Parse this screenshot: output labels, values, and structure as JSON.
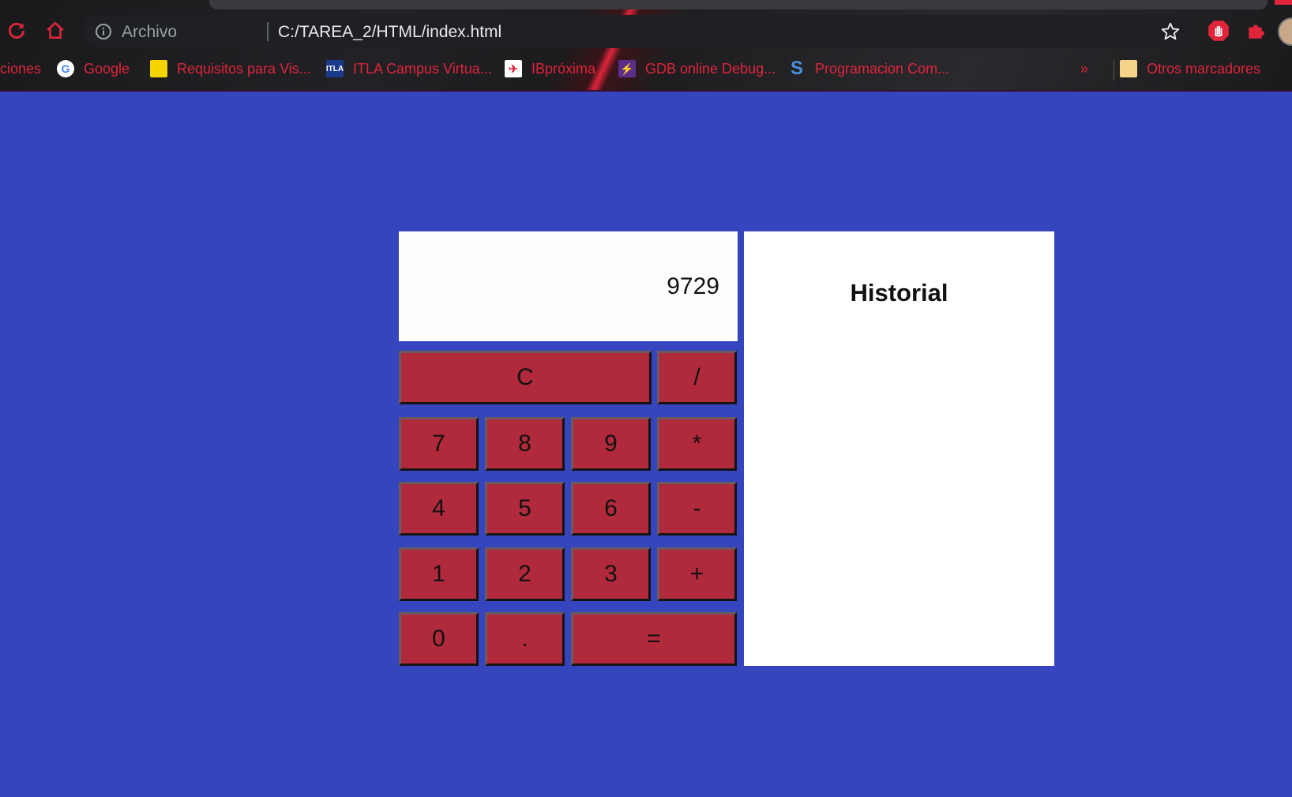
{
  "browser": {
    "origin_label": "Archivo",
    "url": "C:/TAREA_2/HTML/index.html",
    "bookmarks": [
      {
        "label": "ciones",
        "icon": "folder-icon"
      },
      {
        "label": "Google",
        "icon": "google-icon"
      },
      {
        "label": "Requisitos para Vis...",
        "icon": "flag-icon"
      },
      {
        "label": "ITLA Campus Virtua...",
        "icon": "itla-icon"
      },
      {
        "label": "IBpróxima",
        "icon": "iberia-icon"
      },
      {
        "label": "GDB online Debug...",
        "icon": "gdb-icon"
      },
      {
        "label": "Programacion Com...",
        "icon": "s-icon"
      }
    ],
    "overflow_label": "»",
    "other_bookmarks": "Otros marcadores",
    "accent_color": "#e0243a"
  },
  "calculator": {
    "display_value": "9729",
    "keys": {
      "clear": "C",
      "divide": "/",
      "seven": "7",
      "eight": "8",
      "nine": "9",
      "multiply": "*",
      "four": "4",
      "five": "5",
      "six": "6",
      "minus": "-",
      "one": "1",
      "two": "2",
      "three": "3",
      "plus": "+",
      "zero": "0",
      "dot": ".",
      "equals": "="
    },
    "key_color": "#b02a3c",
    "background_color": "#3545bd"
  },
  "history": {
    "title": "Historial"
  }
}
